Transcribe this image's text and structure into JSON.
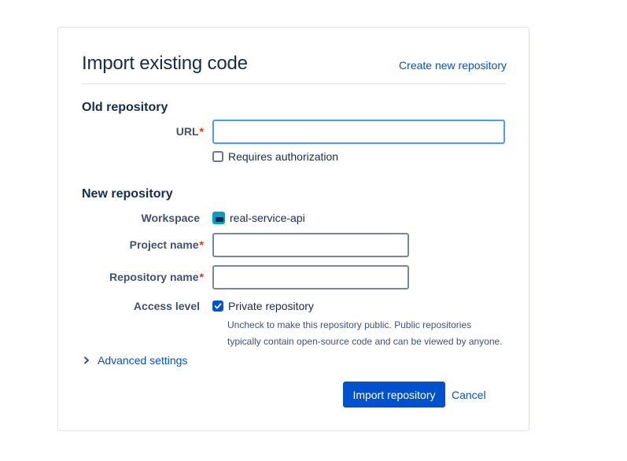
{
  "header": {
    "title": "Import existing code",
    "create_link": "Create new repository"
  },
  "old_repository": {
    "section_title": "Old repository",
    "url_label": "URL",
    "url_value": "",
    "requires_auth_label": "Requires authorization",
    "requires_auth_checked": false
  },
  "new_repository": {
    "section_title": "New repository",
    "workspace_label": "Workspace",
    "workspace_value": "real-service-api",
    "project_label": "Project name",
    "project_value": "",
    "repo_label": "Repository name",
    "repo_value": "",
    "access_label": "Access level",
    "private_label": "Private repository",
    "private_checked": true,
    "help_line1": "Uncheck to make this repository public. Public repositories",
    "help_line2": "typically contain open-source code and can be viewed by anyone."
  },
  "advanced_settings": "Advanced settings",
  "actions": {
    "import_label": "Import repository",
    "cancel_label": "Cancel"
  },
  "required_marker": "*",
  "colors": {
    "primary": "#0052cc",
    "required": "#de350b",
    "focus": "#4c9aff",
    "workspace_icon": "#00a3bf"
  }
}
